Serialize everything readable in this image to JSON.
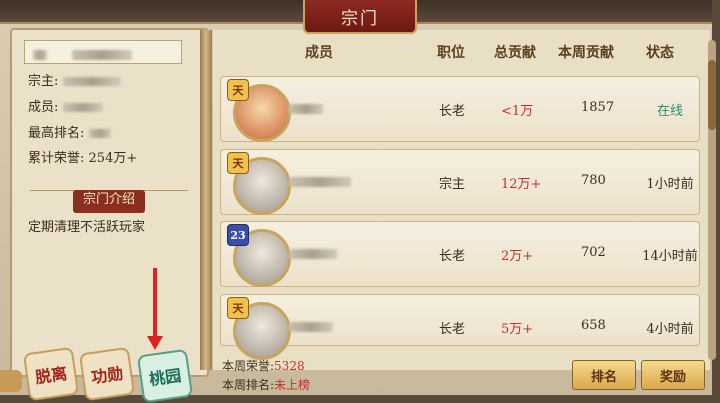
{
  "window": {
    "title": "宗门"
  },
  "left": {
    "master_label": "宗主:",
    "members_label": "成员:",
    "rank_label": "最高排名:",
    "honor_label": "累计荣誉:",
    "honor_value": "254万+",
    "intro_title": "宗门介绍",
    "intro_text": "定期清理不活跃玩家",
    "buttons": {
      "leave": "脱离",
      "merit": "功勋",
      "peach": "桃园"
    }
  },
  "table": {
    "headers": {
      "member": "成员",
      "position": "职位",
      "total": "总贡献",
      "week": "本周贡献",
      "status": "状态"
    },
    "rows": [
      {
        "badge": "天",
        "badge_color": "#f0c24b",
        "position": "长老",
        "total": "<1万",
        "week": "1857",
        "status": "在线"
      },
      {
        "badge": "天",
        "badge_color": "#f0c24b",
        "position": "宗主",
        "total": "12万+",
        "week": "780",
        "status": "1小时前"
      },
      {
        "badge": "23",
        "badge_color": "#3c4fa8",
        "position": "长老",
        "total": "2万+",
        "week": "702",
        "status": "14小时前"
      },
      {
        "badge": "天",
        "badge_color": "#f0c24b",
        "position": "长老",
        "total": "5万+",
        "week": "658",
        "status": "4小时前"
      }
    ]
  },
  "footer": {
    "week_honor_label": "本周荣誉:",
    "week_honor_value": "5328",
    "week_rank_label": "本周排名:",
    "week_rank_value": "未上榜",
    "rank_button": "排名",
    "reward_button": "奖励"
  },
  "colors": {
    "accent_red": "#c0302a",
    "online_green": "#2d8a6e",
    "title_bg": "#8e2a22"
  }
}
